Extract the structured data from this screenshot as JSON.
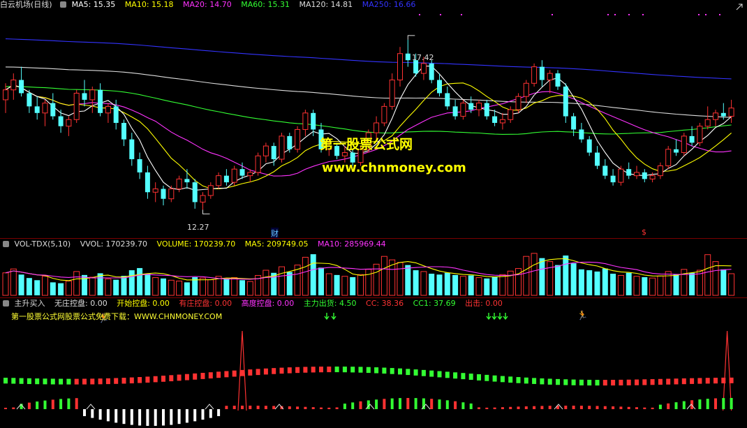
{
  "main_header": {
    "title": "白云机场(日线)",
    "items": [
      {
        "label": "MA5: 15.35",
        "color": "#ffffff"
      },
      {
        "label": "MA10: 15.18",
        "color": "#ffff00"
      },
      {
        "label": "MA20: 14.70",
        "color": "#ff33ff"
      },
      {
        "label": "MA60: 15.31",
        "color": "#33ff33"
      },
      {
        "label": "MA120: 14.81",
        "color": "#dddddd"
      },
      {
        "label": "MA250: 16.66",
        "color": "#3333ff"
      }
    ]
  },
  "vol_header": {
    "title": "VOL-TDX(5,10)",
    "items": [
      {
        "label": "VVOL: 170239.70",
        "color": "#dddddd"
      },
      {
        "label": "VOLUME: 170239.70",
        "color": "#ffff00"
      },
      {
        "label": "MA5: 209749.05",
        "color": "#ffff00"
      },
      {
        "label": "MA10: 285969.44",
        "color": "#ff33ff"
      }
    ]
  },
  "ind_header": {
    "title": "主升买入",
    "items": [
      {
        "label": "无庄控盘: 0.00",
        "color": "#dddddd"
      },
      {
        "label": "开始控盘: 0.00",
        "color": "#ffff00"
      },
      {
        "label": "有庄控盘: 0.00",
        "color": "#ff3333"
      },
      {
        "label": "高度控盘: 0.00",
        "color": "#ff33ff"
      },
      {
        "label": "主力出货: 4.50",
        "color": "#33ff33"
      },
      {
        "label": "CC: 38.36",
        "color": "#ff3333"
      },
      {
        "label": "CC1: 37.69",
        "color": "#33ff33"
      },
      {
        "label": "出击: 0.00",
        "color": "#ff3333"
      }
    ]
  },
  "annotations": {
    "high": "17.42",
    "low": "12.27",
    "cai": "财",
    "dollar": "$",
    "note": "第一股票公式网股票公式免费下载：WWW.CHNMONEY.COM"
  },
  "watermark": {
    "line1": "第一股票公式网",
    "line2": "www.chnmoney.com"
  },
  "colors": {
    "up": "#ff3232",
    "down": "#54ffff",
    "ma5": "#ffffff",
    "ma10": "#ffff00",
    "ma20": "#ff33ff",
    "ma60": "#33ff33",
    "ma120": "#dddddd",
    "ma250": "#3333ff"
  },
  "chart_data": {
    "type": "candlestick",
    "price_range": [
      11.6,
      18.2
    ],
    "candles": [
      [
        15.6,
        16.1,
        15.2,
        15.9
      ],
      [
        15.9,
        16.4,
        15.6,
        16.2
      ],
      [
        16.2,
        16.6,
        15.7,
        15.8
      ],
      [
        15.8,
        15.9,
        15.2,
        15.4
      ],
      [
        15.4,
        15.7,
        15.0,
        15.2
      ],
      [
        15.2,
        15.6,
        14.8,
        15.5
      ],
      [
        15.5,
        15.8,
        15.0,
        15.1
      ],
      [
        15.1,
        15.3,
        14.6,
        14.8
      ],
      [
        14.8,
        15.1,
        14.5,
        15.0
      ],
      [
        15.0,
        15.9,
        14.9,
        15.8
      ],
      [
        15.8,
        16.2,
        15.4,
        15.6
      ],
      [
        15.6,
        16.0,
        15.2,
        15.9
      ],
      [
        15.9,
        16.1,
        15.1,
        15.2
      ],
      [
        15.2,
        15.5,
        14.9,
        15.4
      ],
      [
        15.4,
        15.6,
        14.7,
        14.9
      ],
      [
        14.9,
        15.0,
        14.2,
        14.4
      ],
      [
        14.4,
        14.6,
        13.6,
        13.8
      ],
      [
        13.8,
        14.0,
        13.2,
        13.4
      ],
      [
        13.4,
        13.6,
        12.6,
        12.8
      ],
      [
        12.8,
        13.1,
        12.5,
        12.9
      ],
      [
        12.9,
        13.0,
        12.4,
        12.6
      ],
      [
        12.6,
        13.0,
        12.5,
        12.9
      ],
      [
        12.9,
        13.3,
        12.8,
        13.2
      ],
      [
        13.2,
        13.5,
        12.9,
        13.1
      ],
      [
        13.1,
        13.2,
        12.3,
        12.5
      ],
      [
        12.5,
        12.8,
        12.27,
        12.7
      ],
      [
        12.7,
        13.1,
        12.6,
        13.0
      ],
      [
        13.0,
        13.4,
        12.9,
        13.3
      ],
      [
        13.3,
        13.5,
        13.0,
        13.1
      ],
      [
        13.1,
        13.6,
        13.0,
        13.5
      ],
      [
        13.5,
        13.7,
        13.2,
        13.3
      ],
      [
        13.3,
        13.5,
        13.1,
        13.4
      ],
      [
        13.4,
        14.0,
        13.3,
        13.9
      ],
      [
        13.9,
        14.3,
        13.7,
        14.2
      ],
      [
        14.2,
        14.3,
        13.6,
        13.8
      ],
      [
        13.8,
        14.6,
        13.7,
        14.5
      ],
      [
        14.5,
        14.6,
        14.0,
        14.1
      ],
      [
        14.1,
        14.8,
        14.0,
        14.7
      ],
      [
        14.7,
        15.3,
        14.5,
        15.2
      ],
      [
        15.2,
        15.3,
        14.5,
        14.7
      ],
      [
        14.7,
        14.9,
        14.0,
        14.1
      ],
      [
        14.1,
        14.4,
        13.9,
        14.2
      ],
      [
        14.2,
        14.3,
        13.8,
        13.9
      ],
      [
        13.9,
        14.2,
        13.7,
        14.0
      ],
      [
        14.0,
        14.1,
        13.6,
        13.7
      ],
      [
        13.7,
        14.2,
        13.6,
        14.1
      ],
      [
        14.1,
        14.7,
        14.0,
        14.6
      ],
      [
        14.6,
        15.1,
        14.4,
        14.9
      ],
      [
        14.9,
        15.5,
        14.8,
        15.4
      ],
      [
        15.4,
        16.4,
        15.3,
        16.2
      ],
      [
        16.2,
        17.2,
        16.0,
        17.0
      ],
      [
        17.0,
        17.42,
        16.6,
        16.8
      ],
      [
        16.8,
        17.0,
        16.3,
        16.4
      ],
      [
        16.4,
        16.9,
        16.2,
        16.7
      ],
      [
        16.7,
        16.8,
        16.1,
        16.2
      ],
      [
        16.2,
        16.4,
        15.7,
        15.8
      ],
      [
        15.8,
        16.0,
        15.3,
        15.4
      ],
      [
        15.4,
        15.6,
        15.0,
        15.1
      ],
      [
        15.1,
        15.6,
        15.0,
        15.5
      ],
      [
        15.5,
        15.7,
        15.2,
        15.3
      ],
      [
        15.3,
        15.6,
        15.1,
        15.5
      ],
      [
        15.5,
        15.6,
        15.0,
        15.1
      ],
      [
        15.1,
        15.3,
        14.8,
        14.9
      ],
      [
        14.9,
        15.2,
        14.7,
        15.0
      ],
      [
        15.0,
        15.4,
        14.9,
        15.3
      ],
      [
        15.3,
        15.8,
        15.2,
        15.7
      ],
      [
        15.7,
        16.2,
        15.5,
        16.1
      ],
      [
        16.1,
        16.7,
        16.0,
        16.6
      ],
      [
        16.6,
        16.8,
        16.0,
        16.2
      ],
      [
        16.2,
        16.5,
        15.8,
        16.4
      ],
      [
        16.4,
        16.5,
        15.9,
        16.0
      ],
      [
        16.0,
        16.1,
        14.9,
        15.1
      ],
      [
        15.1,
        15.2,
        14.5,
        14.7
      ],
      [
        14.7,
        14.9,
        14.3,
        14.4
      ],
      [
        14.4,
        14.5,
        13.9,
        14.0
      ],
      [
        14.0,
        14.2,
        13.5,
        13.6
      ],
      [
        13.6,
        13.8,
        13.2,
        13.3
      ],
      [
        13.3,
        13.5,
        13.0,
        13.1
      ],
      [
        13.1,
        13.6,
        13.0,
        13.5
      ],
      [
        13.5,
        13.7,
        13.2,
        13.3
      ],
      [
        13.3,
        13.6,
        13.2,
        13.4
      ],
      [
        13.4,
        13.5,
        13.1,
        13.2
      ],
      [
        13.2,
        13.4,
        13.1,
        13.3
      ],
      [
        13.3,
        13.7,
        13.2,
        13.6
      ],
      [
        13.6,
        14.2,
        13.5,
        14.1
      ],
      [
        14.1,
        14.4,
        13.9,
        14.0
      ],
      [
        14.0,
        14.6,
        13.9,
        14.5
      ],
      [
        14.5,
        14.8,
        14.2,
        14.3
      ],
      [
        14.3,
        14.9,
        14.2,
        14.8
      ],
      [
        14.8,
        15.4,
        14.7,
        15.0
      ],
      [
        15.0,
        15.3,
        14.8,
        15.2
      ],
      [
        15.2,
        15.5,
        15.0,
        15.1
      ],
      [
        15.1,
        15.6,
        14.9,
        15.35
      ]
    ],
    "volume": [
      52,
      61,
      48,
      40,
      35,
      44,
      30,
      28,
      33,
      55,
      47,
      42,
      51,
      38,
      36,
      45,
      58,
      63,
      50,
      41,
      39,
      35,
      33,
      30,
      42,
      40,
      36,
      44,
      38,
      41,
      35,
      32,
      46,
      58,
      52,
      66,
      54,
      70,
      88,
      95,
      64,
      50,
      47,
      44,
      42,
      48,
      60,
      72,
      90,
      82,
      76,
      70,
      58,
      55,
      50,
      48,
      52,
      47,
      44,
      46,
      41,
      39,
      43,
      48,
      56,
      62,
      90,
      97,
      86,
      78,
      70,
      92,
      74,
      60,
      58,
      55,
      62,
      50,
      46,
      52,
      44,
      42,
      40,
      45,
      55,
      49,
      60,
      52,
      58,
      94,
      78,
      60,
      50
    ]
  }
}
